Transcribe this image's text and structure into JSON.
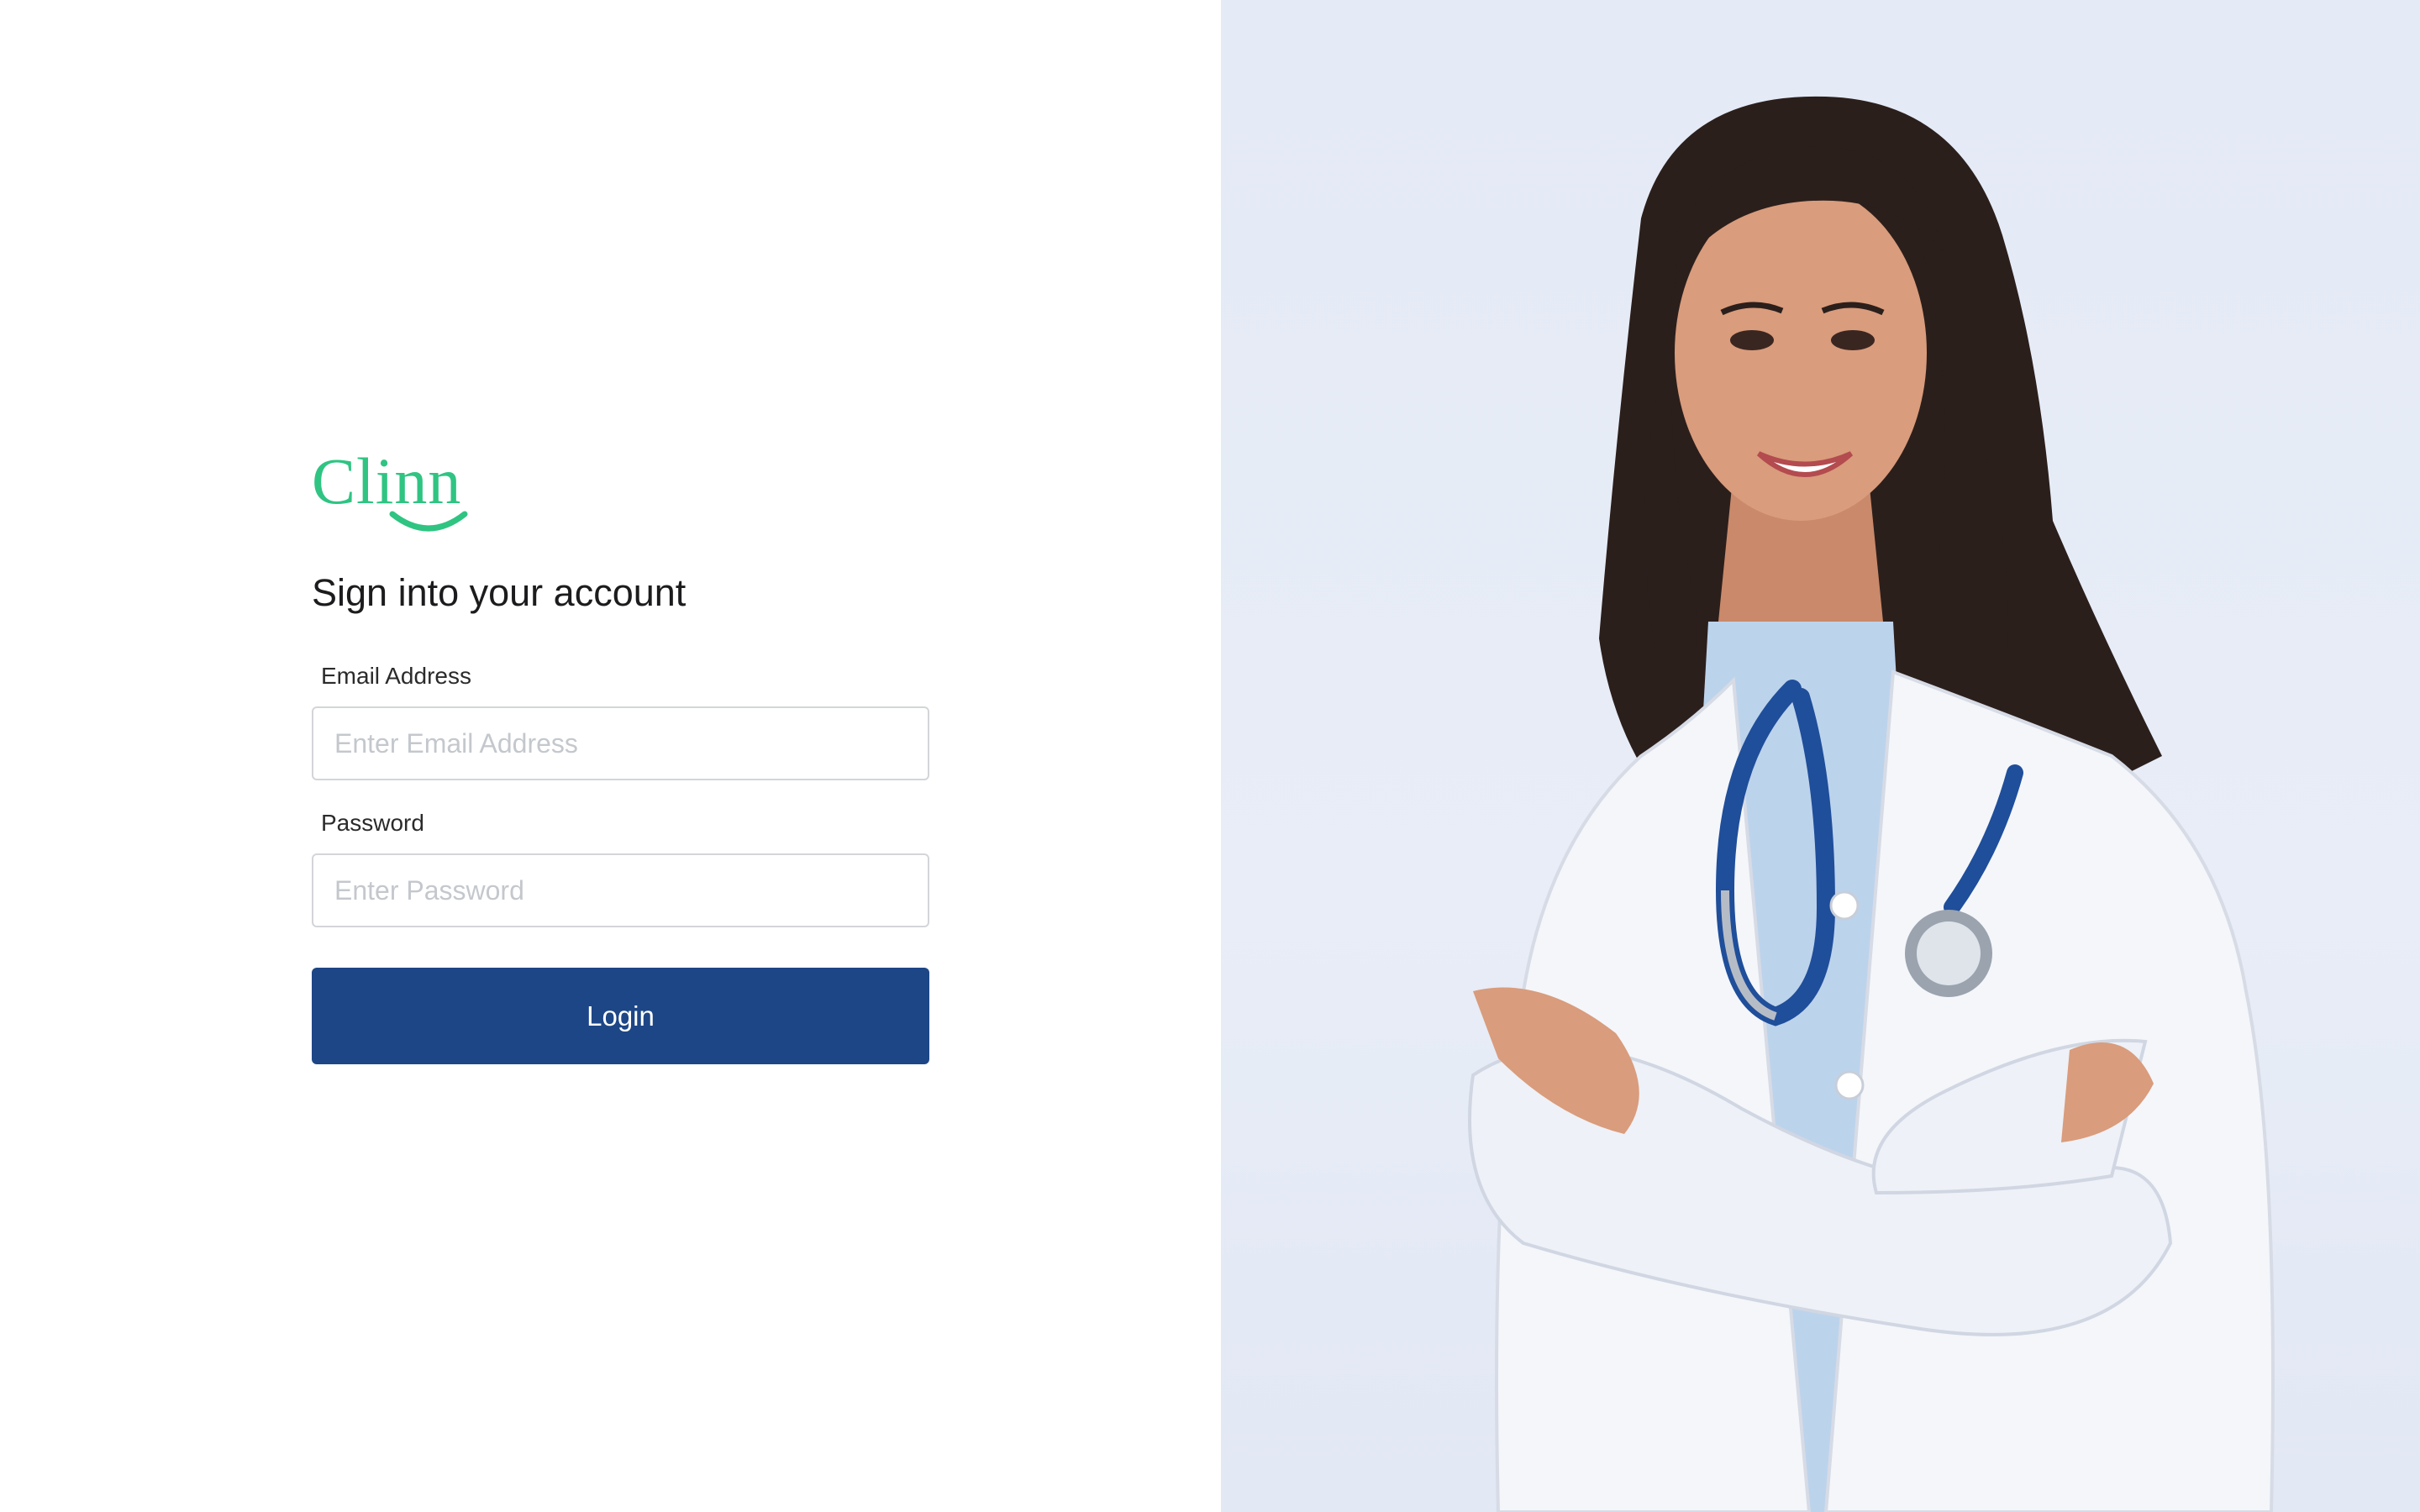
{
  "brand": {
    "name": "Clinn",
    "color": "#2fc482"
  },
  "login": {
    "heading": "Sign into your account",
    "email": {
      "label": "Email Address",
      "placeholder": "Enter Email Address",
      "value": ""
    },
    "password": {
      "label": "Password",
      "placeholder": "Enter Password",
      "value": ""
    },
    "submit_label": "Login",
    "button_color": "#1d4686"
  },
  "hero": {
    "background_color": "#e4eaf6"
  }
}
